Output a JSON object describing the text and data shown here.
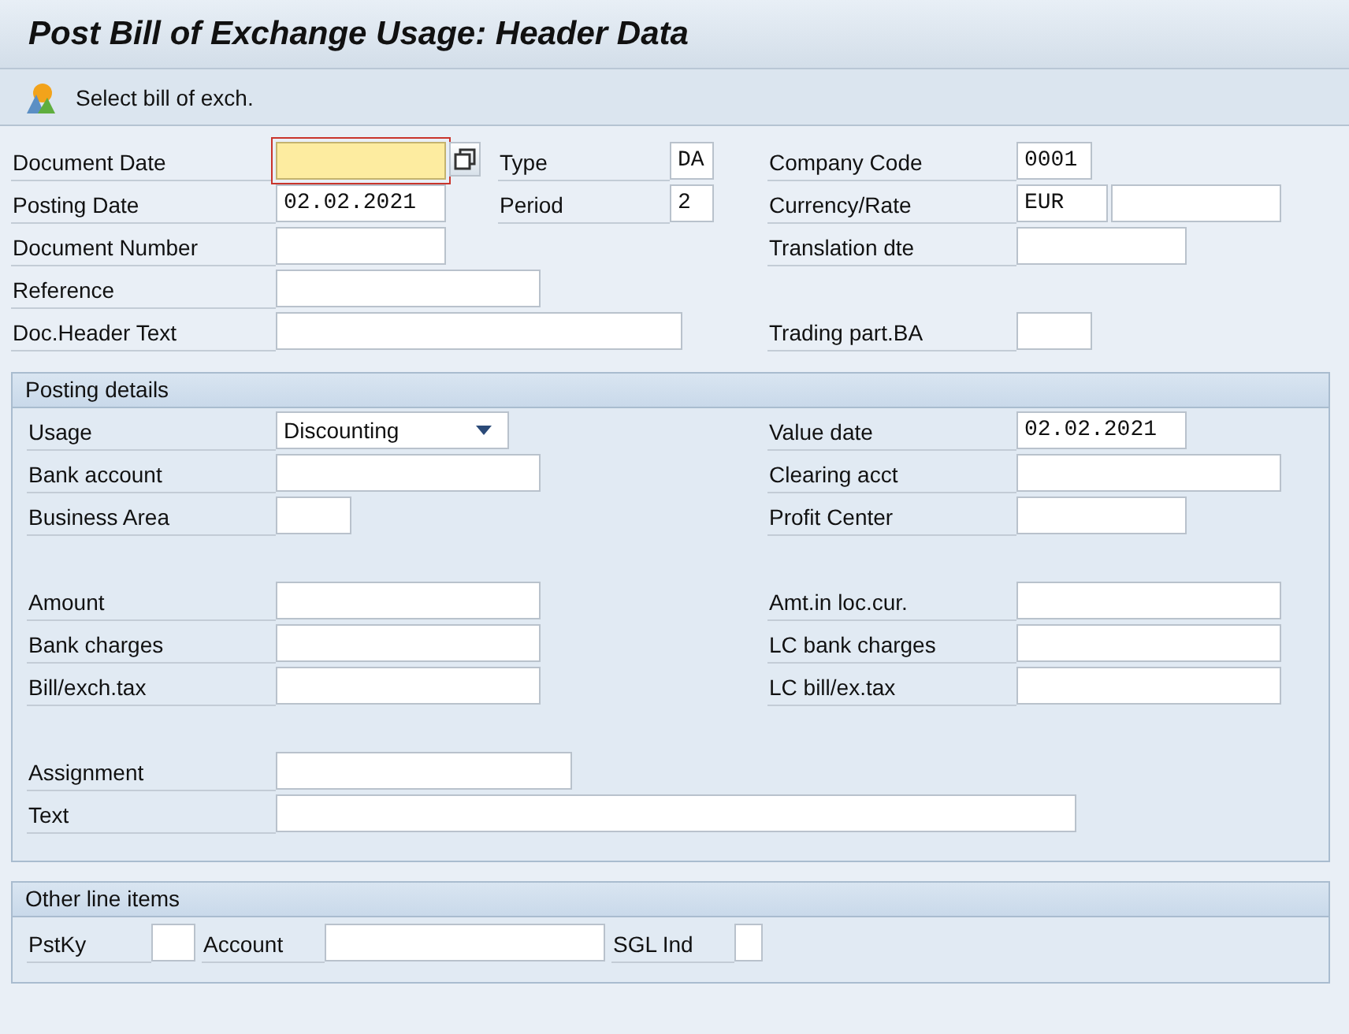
{
  "window": {
    "title": "Post Bill of Exchange Usage: Header Data"
  },
  "toolbar": {
    "button": "Select bill of exch."
  },
  "header_rows": [
    {
      "left": {
        "label": "Document Date",
        "kind": "date",
        "focused": true
      },
      "middle": {
        "label": "Type",
        "value": "DA",
        "kind": "char",
        "focused": false
      },
      "right": {
        "label": "Company Code",
        "value": "0001",
        "kind": "code",
        "focused": false
      }
    },
    {
      "left": {
        "label": "Posting Date",
        "value": "02.02.2021",
        "kind": "date",
        "focused": false
      },
      "middle": {
        "label": "Period",
        "value": "2",
        "kind": "char",
        "focused": false
      },
      "right": {
        "label": "Currency/Rate",
        "value": "EUR",
        "kind": "curr",
        "focused": false
      }
    },
    {
      "left": {
        "label": "Document Number",
        "kind": "date",
        "focused": false
      },
      "right": {
        "label": "Translation dte",
        "kind": "date",
        "focused": false
      }
    },
    {
      "left": {
        "label": "Reference",
        "kind": "text",
        "focused": false
      }
    },
    {
      "left": {
        "label": "Doc.Header Text",
        "kind": "header",
        "focused": false
      },
      "right": {
        "label": "Trading part.BA",
        "kind": "code",
        "focused": false
      }
    }
  ],
  "posting_details": {
    "title": "Posting details",
    "groups": [
      [
        {
          "left": {
            "label": "Usage",
            "value": "Discounting",
            "kind": "select"
          },
          "right": {
            "label": "Value date",
            "value": "02.02.2021",
            "kind": "date"
          }
        },
        {
          "left": {
            "label": "Bank account",
            "kind": "text"
          },
          "right": {
            "label": "Clearing acct",
            "kind": "text"
          }
        },
        {
          "left": {
            "label": "Business Area",
            "kind": "code"
          },
          "right": {
            "label": "Profit Center",
            "kind": "date"
          }
        }
      ],
      [
        {
          "left": {
            "label": "Amount",
            "kind": "text"
          },
          "right": {
            "label": "Amt.in loc.cur.",
            "kind": "text"
          }
        },
        {
          "left": {
            "label": "Bank charges",
            "kind": "text"
          },
          "right": {
            "label": "LC bank charges",
            "kind": "text"
          }
        },
        {
          "left": {
            "label": "Bill/exch.tax",
            "kind": "text"
          },
          "right": {
            "label": "LC bill/ex.tax",
            "kind": "text"
          }
        }
      ],
      [
        {
          "left": {
            "label": "Assignment",
            "kind": "assign"
          }
        },
        {
          "left": {
            "label": "Text",
            "kind": "long"
          }
        }
      ]
    ]
  },
  "other_line_items": {
    "title": "Other line items",
    "fields": [
      {
        "label": "PstKy",
        "kind": "char"
      },
      {
        "label": "Account",
        "kind": "account"
      },
      {
        "label": "SGL Ind",
        "kind": "flag"
      }
    ]
  }
}
